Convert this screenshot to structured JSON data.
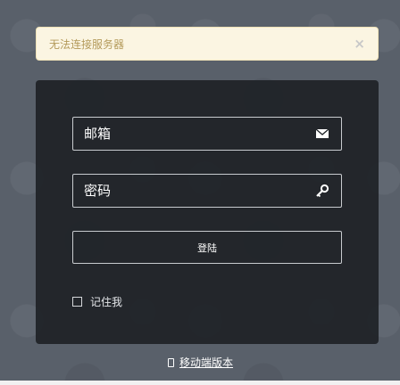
{
  "alert": {
    "message": "无法连接服务器",
    "close_symbol": "×"
  },
  "form": {
    "email": {
      "placeholder": "邮箱",
      "value": "",
      "icon": "envelope-icon"
    },
    "password": {
      "placeholder": "密码",
      "value": "",
      "icon": "key-icon"
    },
    "login_label": "登陆",
    "remember_label": "记住我",
    "remember_checked": false
  },
  "footer": {
    "mobile_label": "移动端版本",
    "icon": "mobile-phone-icon"
  },
  "colors": {
    "background": "#59606a",
    "panel": "#1e2226",
    "alert_bg": "#fbf5e2",
    "alert_text": "#b49a5a"
  }
}
